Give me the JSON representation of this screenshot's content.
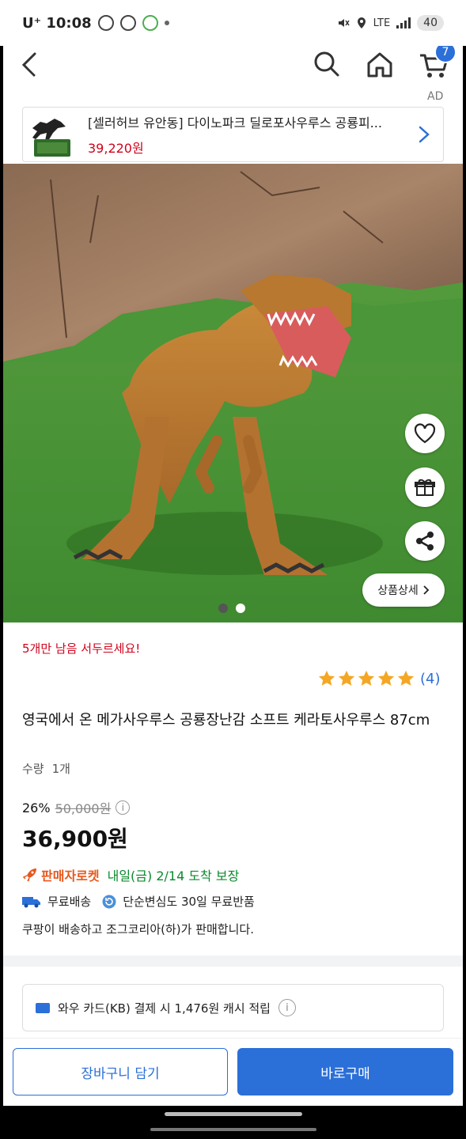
{
  "statusbar": {
    "carrier_time": "U⁺ 10:08",
    "network": "LTE",
    "battery": "40"
  },
  "topnav": {
    "cart_badge": "7",
    "ad_tag": "AD"
  },
  "ad": {
    "title": "[셀러허브 유안동] 다이노파크 딜로포사우루스 공룡피...",
    "price": "39,220원"
  },
  "hero": {
    "detail_label": "상품상세",
    "page_count": 2,
    "active_page": 1
  },
  "product": {
    "stock_note": "5개만 남음 서두르세요!",
    "rating_stars": 5,
    "review_count": "(4)",
    "title": "영국에서 온 메가사우루스 공룡장난감 소프트 케라토사우루스 87cm",
    "qty_label": "수량",
    "qty_value": "1개",
    "discount_pct": "26%",
    "original_price": "50,000원",
    "price": "36,900원",
    "rocket_label": "판매자로켓",
    "eta": "내일(금) 2/14 도착 보장",
    "free_shipping": "무료배송",
    "free_return": "단순변심도 30일 무료반품",
    "seller_note": "쿠팡이 배송하고 조그코리아(하)가 판매합니다."
  },
  "card_offer": "와우 카드(KB) 결제 시 1,476원 캐시 적립",
  "buttons": {
    "add_cart": "장바구니 담기",
    "buy_now": "바로구매"
  },
  "colors": {
    "accent": "#2b6fd8",
    "sale_red": "#d0021b",
    "rocket_orange": "#e8571c",
    "eta_green": "#0a8a2c",
    "star": "#f5a623"
  }
}
